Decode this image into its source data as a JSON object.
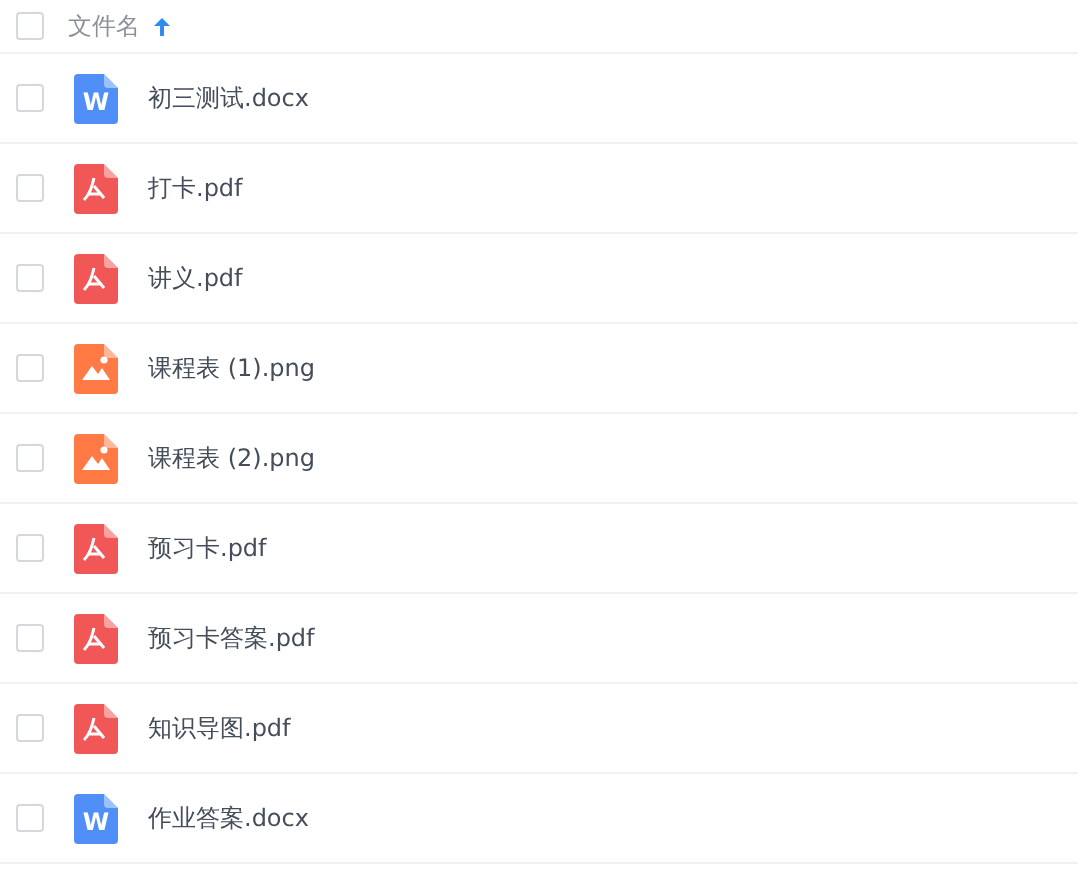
{
  "header": {
    "checked": false,
    "label": "文件名",
    "sort_ascending": true
  },
  "files": [
    {
      "name": "初三测试.docx",
      "kind": "word",
      "icon_letter": "W",
      "checked": false
    },
    {
      "name": "打卡.pdf",
      "kind": "pdf",
      "checked": false
    },
    {
      "name": "讲义.pdf",
      "kind": "pdf",
      "checked": false
    },
    {
      "name": "课程表 (1).png",
      "kind": "image",
      "checked": false
    },
    {
      "name": "课程表 (2).png",
      "kind": "image",
      "checked": false
    },
    {
      "name": "预习卡.pdf",
      "kind": "pdf",
      "checked": false
    },
    {
      "name": "预习卡答案.pdf",
      "kind": "pdf",
      "checked": false
    },
    {
      "name": "知识导图.pdf",
      "kind": "pdf",
      "checked": false
    },
    {
      "name": "作业答案.docx",
      "kind": "word",
      "icon_letter": "W",
      "checked": false
    }
  ]
}
